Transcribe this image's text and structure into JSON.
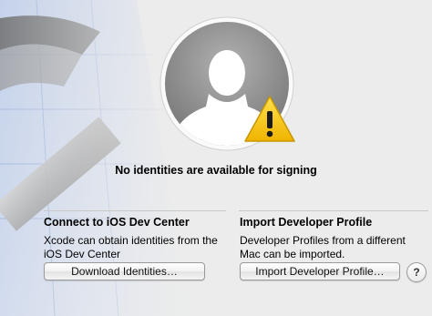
{
  "status": {
    "headline": "No identities are available for signing",
    "avatar_icon": "user-silhouette-icon",
    "badge_icon": "warning-triangle-icon"
  },
  "connect": {
    "title": "Connect to iOS Dev Center",
    "description": "Xcode can obtain identities from the iOS Dev Center",
    "button_label": "Download Identities…"
  },
  "import": {
    "title": "Import Developer Profile",
    "description": "Developer Profiles from a different Mac can be imported.",
    "button_label": "Import Developer Profile…"
  },
  "help": {
    "label": "?"
  },
  "colors": {
    "warning": "#f2c200",
    "avatar": "#8c8c8c"
  }
}
